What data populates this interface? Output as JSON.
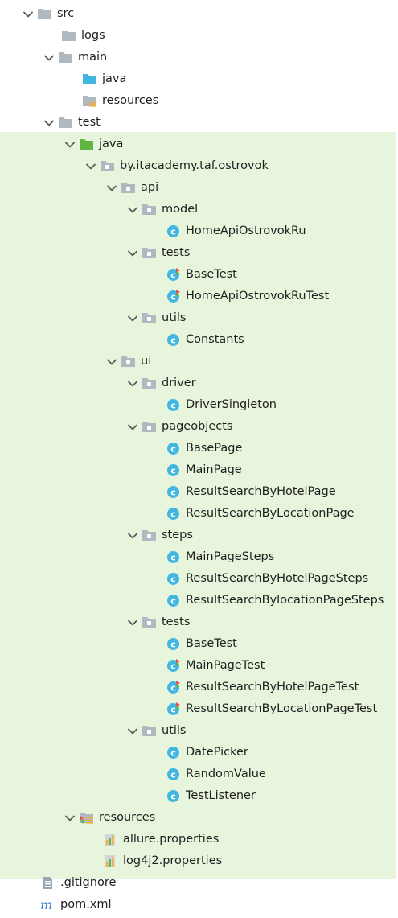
{
  "tree": [
    {
      "label": "src",
      "indent": 0,
      "expanded": true,
      "icon": "folder-gray",
      "group": "src"
    },
    {
      "label": "logs",
      "indent": 1,
      "expanded": null,
      "icon": "folder-gray",
      "group": "src"
    },
    {
      "label": "main",
      "indent": 1,
      "expanded": true,
      "icon": "folder-gray",
      "group": "src"
    },
    {
      "label": "java",
      "indent": 2,
      "expanded": null,
      "icon": "folder-blue",
      "group": "src"
    },
    {
      "label": "resources",
      "indent": 2,
      "expanded": null,
      "icon": "folder-resources",
      "group": "src"
    },
    {
      "label": "test",
      "indent": 1,
      "expanded": true,
      "icon": "folder-gray",
      "group": "src"
    },
    {
      "label": "java",
      "indent": 2,
      "expanded": true,
      "icon": "folder-green",
      "group": "test"
    },
    {
      "label": "by.itacademy.taf.ostrovok",
      "indent": 3,
      "expanded": true,
      "icon": "package",
      "group": "test"
    },
    {
      "label": "api",
      "indent": 4,
      "expanded": true,
      "icon": "package",
      "group": "test"
    },
    {
      "label": "model",
      "indent": 5,
      "expanded": true,
      "icon": "package",
      "group": "test"
    },
    {
      "label": "HomeApiOstrovokRu",
      "indent": 6,
      "expanded": null,
      "icon": "class",
      "group": "test"
    },
    {
      "label": "tests",
      "indent": 5,
      "expanded": true,
      "icon": "package",
      "group": "test"
    },
    {
      "label": "BaseTest",
      "indent": 6,
      "expanded": null,
      "icon": "test-class",
      "group": "test"
    },
    {
      "label": "HomeApiOstrovokRuTest",
      "indent": 6,
      "expanded": null,
      "icon": "test-class",
      "group": "test"
    },
    {
      "label": "utils",
      "indent": 5,
      "expanded": true,
      "icon": "package",
      "group": "test"
    },
    {
      "label": "Constants",
      "indent": 6,
      "expanded": null,
      "icon": "class",
      "group": "test"
    },
    {
      "label": "ui",
      "indent": 4,
      "expanded": true,
      "icon": "package",
      "group": "test"
    },
    {
      "label": "driver",
      "indent": 5,
      "expanded": true,
      "icon": "package",
      "group": "test"
    },
    {
      "label": "DriverSingleton",
      "indent": 6,
      "expanded": null,
      "icon": "class",
      "group": "test"
    },
    {
      "label": "pageobjects",
      "indent": 5,
      "expanded": true,
      "icon": "package",
      "group": "test"
    },
    {
      "label": "BasePage",
      "indent": 6,
      "expanded": null,
      "icon": "class",
      "group": "test"
    },
    {
      "label": "MainPage",
      "indent": 6,
      "expanded": null,
      "icon": "class",
      "group": "test"
    },
    {
      "label": "ResultSearchByHotelPage",
      "indent": 6,
      "expanded": null,
      "icon": "class",
      "group": "test"
    },
    {
      "label": "ResultSearchByLocationPage",
      "indent": 6,
      "expanded": null,
      "icon": "class",
      "group": "test"
    },
    {
      "label": "steps",
      "indent": 5,
      "expanded": true,
      "icon": "package",
      "group": "test"
    },
    {
      "label": "MainPageSteps",
      "indent": 6,
      "expanded": null,
      "icon": "class",
      "group": "test"
    },
    {
      "label": "ResultSearchByHotelPageSteps",
      "indent": 6,
      "expanded": null,
      "icon": "class",
      "group": "test"
    },
    {
      "label": "ResultSearchBylocationPageSteps",
      "indent": 6,
      "expanded": null,
      "icon": "class",
      "group": "test"
    },
    {
      "label": "tests",
      "indent": 5,
      "expanded": true,
      "icon": "package",
      "group": "test"
    },
    {
      "label": "BaseTest",
      "indent": 6,
      "expanded": null,
      "icon": "class",
      "group": "test"
    },
    {
      "label": "MainPageTest",
      "indent": 6,
      "expanded": null,
      "icon": "test-class",
      "group": "test"
    },
    {
      "label": "ResultSearchByHotelPageTest",
      "indent": 6,
      "expanded": null,
      "icon": "test-class",
      "group": "test"
    },
    {
      "label": "ResultSearchByLocationPageTest",
      "indent": 6,
      "expanded": null,
      "icon": "test-class",
      "group": "test"
    },
    {
      "label": "utils",
      "indent": 5,
      "expanded": true,
      "icon": "package",
      "group": "test"
    },
    {
      "label": "DatePicker",
      "indent": 6,
      "expanded": null,
      "icon": "class",
      "group": "test"
    },
    {
      "label": "RandomValue",
      "indent": 6,
      "expanded": null,
      "icon": "class",
      "group": "test"
    },
    {
      "label": "TestListener",
      "indent": 6,
      "expanded": null,
      "icon": "class",
      "group": "test"
    },
    {
      "label": "resources",
      "indent": 2,
      "expanded": true,
      "icon": "folder-test-resources",
      "group": "test"
    },
    {
      "label": "allure.properties",
      "indent": 3,
      "expanded": null,
      "icon": "properties-file",
      "group": "test"
    },
    {
      "label": "log4j2.properties",
      "indent": 3,
      "expanded": null,
      "icon": "properties-file",
      "group": "test"
    },
    {
      "label": ".gitignore",
      "indent": 0,
      "expanded": null,
      "icon": "text-file",
      "group": "root"
    },
    {
      "label": "pom.xml",
      "indent": 0,
      "expanded": null,
      "icon": "maven-file",
      "group": "root"
    }
  ],
  "colors": {
    "test_background": "#e6f5dc",
    "folder_gray": "#aeb9c0",
    "folder_blue": "#40b6e0",
    "folder_green": "#62b543",
    "class_blue": "#40b6e0",
    "text": "#1f1f1f"
  }
}
